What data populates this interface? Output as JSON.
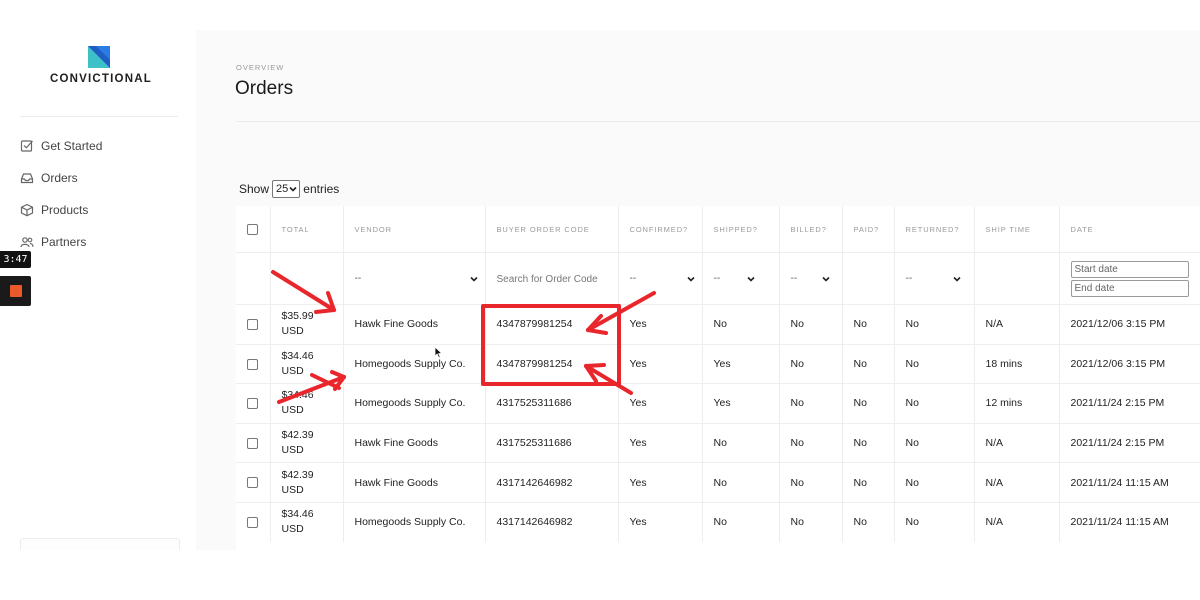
{
  "colors": {
    "annotation": "#e8262b",
    "logo_teal": "#3ec0c8",
    "logo_blue": "#2a7be4",
    "recorder_stop": "#ea5a2c"
  },
  "sidebar": {
    "logo_text": "CONVICTIONAL",
    "items": [
      {
        "label": "Get Started",
        "icon": "checkbox-icon"
      },
      {
        "label": "Orders",
        "icon": "inbox-icon"
      },
      {
        "label": "Products",
        "icon": "box-icon"
      },
      {
        "label": "Partners",
        "icon": "people-icon"
      }
    ]
  },
  "recorder": {
    "time": "3:47"
  },
  "header": {
    "eyebrow": "OVERVIEW",
    "title": "Orders"
  },
  "entries": {
    "show_label": "Show",
    "value": "25",
    "entries_label": "entries"
  },
  "table": {
    "columns": [
      "TOTAL",
      "VENDOR",
      "BUYER ORDER CODE",
      "CONFIRMED?",
      "SHIPPED?",
      "BILLED?",
      "PAID?",
      "RETURNED?",
      "SHIP TIME",
      "DATE"
    ],
    "filters": {
      "vendor": "--",
      "order_code_placeholder": "Search for Order Code",
      "confirmed": "--",
      "shipped": "--",
      "billed": "--",
      "returned": "--",
      "start_date_placeholder": "Start date",
      "end_date_placeholder": "End date"
    },
    "rows": [
      {
        "amount": "$35.99",
        "currency": "USD",
        "vendor": "Hawk Fine Goods",
        "code": "4347879981254",
        "confirmed": "Yes",
        "shipped": "No",
        "billed": "No",
        "paid": "No",
        "returned": "No",
        "ship_time": "N/A",
        "date": "2021/12/06 3:15 PM"
      },
      {
        "amount": "$34.46",
        "currency": "USD",
        "vendor": "Homegoods Supply Co.",
        "code": "4347879981254",
        "confirmed": "Yes",
        "shipped": "Yes",
        "billed": "No",
        "paid": "No",
        "returned": "No",
        "ship_time": "18 mins",
        "date": "2021/12/06 3:15 PM"
      },
      {
        "amount": "$34.46",
        "currency": "USD",
        "vendor": "Homegoods Supply Co.",
        "code": "4317525311686",
        "confirmed": "Yes",
        "shipped": "Yes",
        "billed": "No",
        "paid": "No",
        "returned": "No",
        "ship_time": "12 mins",
        "date": "2021/11/24 2:15 PM"
      },
      {
        "amount": "$42.39",
        "currency": "USD",
        "vendor": "Hawk Fine Goods",
        "code": "4317525311686",
        "confirmed": "Yes",
        "shipped": "No",
        "billed": "No",
        "paid": "No",
        "returned": "No",
        "ship_time": "N/A",
        "date": "2021/11/24 2:15 PM"
      },
      {
        "amount": "$42.39",
        "currency": "USD",
        "vendor": "Hawk Fine Goods",
        "code": "4317142646982",
        "confirmed": "Yes",
        "shipped": "No",
        "billed": "No",
        "paid": "No",
        "returned": "No",
        "ship_time": "N/A",
        "date": "2021/11/24 11:15 AM"
      },
      {
        "amount": "$34.46",
        "currency": "USD",
        "vendor": "Homegoods Supply Co.",
        "code": "4317142646982",
        "confirmed": "Yes",
        "shipped": "No",
        "billed": "No",
        "paid": "No",
        "returned": "No",
        "ship_time": "N/A",
        "date": "2021/11/24 11:15 AM"
      }
    ]
  }
}
